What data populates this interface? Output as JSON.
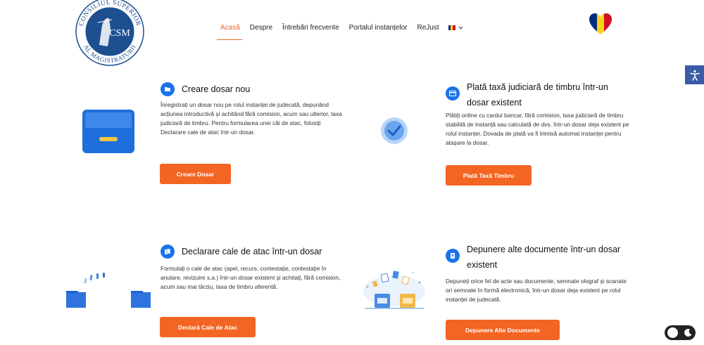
{
  "header": {
    "logo_text": "CONSILIUL SUPERIOR AL MAGISTRATURII",
    "logo_abbr": "CSM",
    "nav": [
      {
        "label": "Acasă",
        "active": true
      },
      {
        "label": "Despre",
        "active": false
      },
      {
        "label": "Întrebări frecvente",
        "active": false
      },
      {
        "label": "Portalul instanțelor",
        "active": false
      },
      {
        "label": "ReJust",
        "active": false
      }
    ],
    "language_icon": "romanian-flag-icon",
    "dropdown_icon": "chevron-down-icon"
  },
  "colors": {
    "accent": "#f26522",
    "brand_blue": "#1a73e8",
    "logo_blue": "#1d4f91",
    "accessibility_bg": "#3b5ba8"
  },
  "cards": [
    {
      "title": "Creare dosar nou",
      "icon": "folder-icon",
      "text": "Înregistrați un dosar nou pe rolul instanței de judecată, depunând acțiunea introductivă și achitând fără comision, acum sau ulterior, taxa judiciară de timbru. Pentru formularea unei căi de atac, folosiți Declarare cale de atac într-un dosar.",
      "button": "Creare Dosar"
    },
    {
      "title": "Plată taxă judiciară de timbru într-un dosar existent",
      "icon": "card-icon",
      "text": "Plătiți online cu cardul bancar, fără comision, taxa judiciară de timbru stabilită de instanță sau calculată de dvs. într-un dosar deja existent pe rolul instanței. Dovada de plată va fi trimisă automat instanței pentru atașare la dosar.",
      "button": "Plată Taxă Timbru"
    },
    {
      "title": "Declarare cale de atac într-un dosar",
      "icon": "documents-icon",
      "text": "Formulați o cale de atac (apel, recurs, contestație, contestație în anulare, revizuire s.a.) într-un dosar existent și achitați, fără comision, acum sau mai târziu, taxa de timbru aferentă.",
      "button": "Declară Cale de Atac"
    },
    {
      "title": "Depunere alte documente într-un dosar existent",
      "icon": "upload-document-icon",
      "text": "Depuneți orice fel de acte sau documente, semnate olograf și scanate ori semnate în formă electronică, într-un dosar deja existent pe rolul instanței de judecată.",
      "button": "Depunere Alte Documente"
    }
  ],
  "widgets": {
    "accessibility_icon": "accessibility-icon",
    "dark_mode_icon": "moon-icon"
  }
}
